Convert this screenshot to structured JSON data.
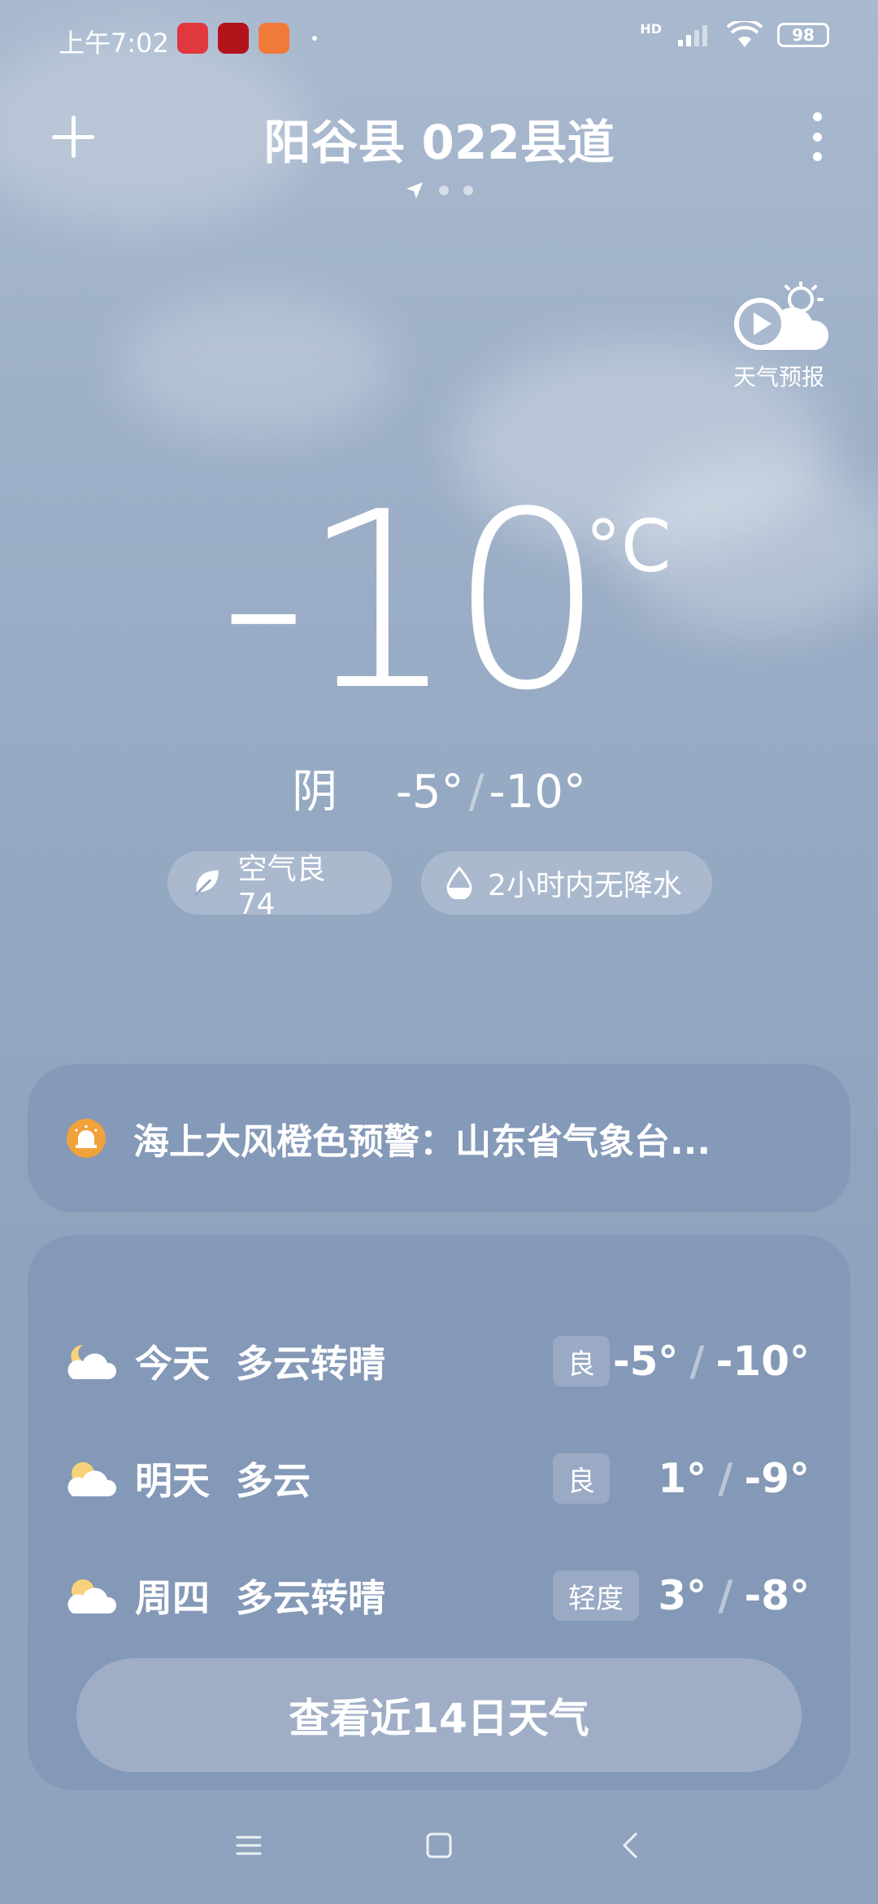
{
  "status": {
    "time": "上午7:02",
    "network": "HD",
    "battery": "98",
    "app_icons": [
      "xiaohongshu-app-icon",
      "app-icon-red",
      "shopping-app-icon"
    ]
  },
  "header": {
    "location": "阳谷县 022县道",
    "pages": 3,
    "current_page": 0
  },
  "forecast_video": {
    "label": "天气预报"
  },
  "current": {
    "temperature": "-10",
    "unit": "°C",
    "condition": "阴",
    "high": "-5°",
    "separator": "/",
    "low": "-10°"
  },
  "pills": {
    "aqi": "空气良 74",
    "rain": "2小时内无降水"
  },
  "alert": {
    "text": "海上大风橙色预警：山东省气象台...",
    "color": "#f2a23b"
  },
  "forecast": [
    {
      "day": "今天",
      "desc": "多云转晴",
      "aq": "良",
      "high": "-5°",
      "low": "-10°",
      "icon": "partly-cloudy-icon"
    },
    {
      "day": "明天",
      "desc": "多云",
      "aq": "良",
      "high": "1°",
      "low": "-9°",
      "icon": "cloudy-sun-icon"
    },
    {
      "day": "周四",
      "desc": "多云转晴",
      "aq": "轻度",
      "high": "3°",
      "low": "-8°",
      "icon": "cloudy-sun-icon"
    }
  ],
  "cta": {
    "label": "查看近14日天气"
  },
  "nav": {
    "icons": [
      "menu-icon",
      "home-icon",
      "back-icon"
    ]
  }
}
